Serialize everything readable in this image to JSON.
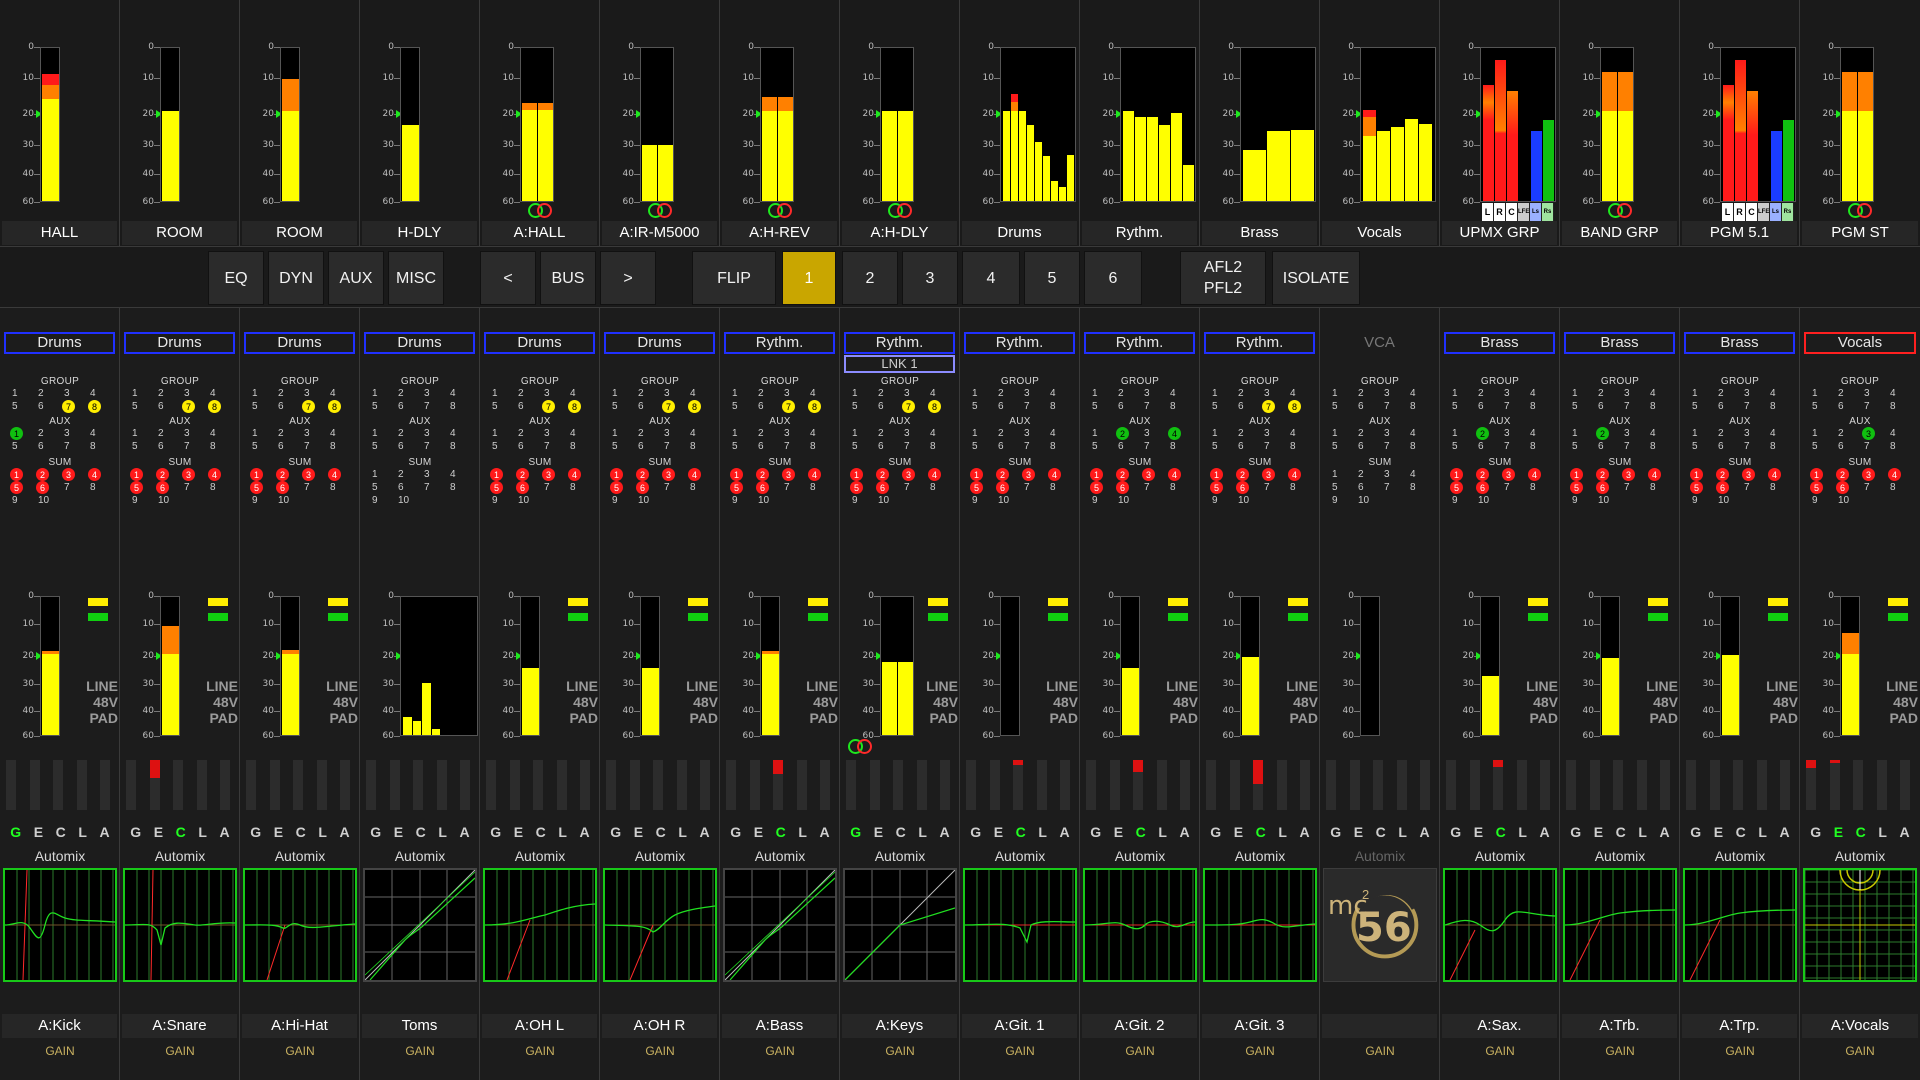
{
  "bridge": [
    {
      "name": "HALL",
      "fill": [
        0.66,
        0.09,
        0.07
      ],
      "bars": 1
    },
    {
      "name": "ROOM",
      "fill": [
        0.58,
        0.0,
        0.0
      ],
      "bars": 1
    },
    {
      "name": "ROOM",
      "fill": [
        0.58,
        0.21,
        0.0
      ],
      "bars": 1
    },
    {
      "name": "H-DLY",
      "fill": [
        0.49,
        0.0,
        0.0
      ],
      "bars": 1
    },
    {
      "name": "A:HALL",
      "fill": [
        0.59,
        0.04,
        0.0
      ],
      "bars": 2,
      "rings": true
    },
    {
      "name": "A:IR-M5000",
      "fill": [
        0.36,
        0.0,
        0.0
      ],
      "bars": 2,
      "rings": true
    },
    {
      "name": "A:H-REV",
      "fill": [
        0.58,
        0.09,
        0.0
      ],
      "bars": 2,
      "rings": true
    },
    {
      "name": "A:H-DLY",
      "fill": [
        0.58,
        0.0,
        0.0
      ],
      "bars": 2,
      "rings": true
    },
    {
      "name": "Drums",
      "multi": [
        0.58,
        0.58,
        0.58,
        0.49,
        0.38,
        0.29,
        0.13,
        0.09,
        0.3
      ]
    },
    {
      "name": "Rythm.",
      "multi": [
        0.58,
        0.54,
        0.54,
        0.49,
        0.57,
        0.23
      ]
    },
    {
      "name": "Brass",
      "multi": [
        0.33,
        0.45,
        0.46
      ]
    },
    {
      "name": "Vocals",
      "multi": [
        0.58,
        0.52,
        0.48,
        0.53,
        0.5
      ]
    },
    {
      "name": "UPMX GRP",
      "upmx": true,
      "chlabels": [
        "L",
        "R",
        "C",
        "LFE",
        "Ls",
        "Rs"
      ]
    },
    {
      "name": "BAND GRP",
      "fill": [
        0.58,
        0.25,
        0.0
      ],
      "bars": 2,
      "rings": true
    },
    {
      "name": "PGM 5.1",
      "upmx": true,
      "chlabels": [
        "L",
        "R",
        "C",
        "LFE",
        "Ls",
        "Rs"
      ]
    },
    {
      "name": "PGM ST",
      "fill": [
        0.58,
        0.25,
        0.0
      ],
      "bars": 2,
      "rings": true
    }
  ],
  "scale_labels": [
    "0",
    "10",
    "20",
    "30",
    "40",
    "60"
  ],
  "buttons": {
    "eq": "EQ",
    "dyn": "DYN",
    "aux": "AUX",
    "misc": "MISC",
    "prev": "<",
    "bus": "BUS",
    "next": ">",
    "flip": "FLIP",
    "bank1": "1",
    "bank2": "2",
    "bank3": "3",
    "bank4": "4",
    "bank5": "5",
    "bank6": "6",
    "afl": "AFL2",
    "pfl": "PFL2",
    "isolate": "ISOLATE"
  },
  "labels": {
    "group": "GROUP",
    "aux": "AUX",
    "sum": "SUM",
    "src_line": "LINE",
    "src_48v": "48V",
    "src_pad": "PAD",
    "automix": "Automix",
    "gain": "GAIN",
    "lnk": "LNK 1",
    "gecla": [
      "G",
      "E",
      "C",
      "L",
      "A"
    ],
    "logo_mc": "mc",
    "logo_sup": "2",
    "logo_num": "56"
  },
  "channels": [
    {
      "tag": "Drums",
      "name": "A:Kick",
      "group": [
        7,
        8
      ],
      "aux": [
        1
      ],
      "sum": [
        1,
        2,
        3,
        4,
        5,
        6
      ],
      "meter": [
        0.58,
        0.02,
        0.0
      ],
      "dyn": [
        0,
        0,
        0,
        0,
        0
      ],
      "gecla_on": [
        0
      ],
      "graph": "eq1"
    },
    {
      "tag": "Drums",
      "name": "A:Snare",
      "group": [
        7,
        8
      ],
      "aux": [],
      "sum": [
        1,
        2,
        3,
        4,
        5,
        6
      ],
      "meter": [
        0.58,
        0.2,
        0.0
      ],
      "dyn": [
        0,
        0.36,
        0,
        0,
        0
      ],
      "gecla_on": [
        2
      ],
      "graph": "eq2"
    },
    {
      "tag": "Drums",
      "name": "A:Hi-Hat",
      "group": [
        7,
        8
      ],
      "aux": [],
      "sum": [
        1,
        2,
        3,
        4,
        5,
        6
      ],
      "meter": [
        0.58,
        0.03,
        0.0
      ],
      "dyn": [
        0,
        0,
        0,
        0,
        0
      ],
      "gecla_on": [],
      "graph": "eq3"
    },
    {
      "tag": "Drums",
      "name": "Toms",
      "group": [],
      "aux": [],
      "sum": [],
      "multi": [
        0.13,
        0.1,
        0.37,
        0.04,
        0,
        0,
        0,
        0
      ],
      "dyn": [
        0,
        0,
        0,
        0,
        0
      ],
      "gecla_on": [],
      "graph": "dyn1",
      "white": true
    },
    {
      "tag": "Drums",
      "name": "A:OH L",
      "group": [
        7,
        8
      ],
      "aux": [],
      "sum": [
        1,
        2,
        3,
        4,
        5,
        6
      ],
      "meter": [
        0.48,
        0.0,
        0.0
      ],
      "dyn": [
        0,
        0,
        0,
        0,
        0
      ],
      "gecla_on": [],
      "graph": "eq4"
    },
    {
      "tag": "Drums",
      "name": "A:OH R",
      "group": [
        7,
        8
      ],
      "aux": [],
      "sum": [
        1,
        2,
        3,
        4,
        5,
        6
      ],
      "meter": [
        0.48,
        0.0,
        0.0
      ],
      "dyn": [
        0,
        0,
        0,
        0,
        0
      ],
      "gecla_on": [],
      "graph": "eq5"
    },
    {
      "tag": "Rythm.",
      "name": "A:Bass",
      "group": [
        7,
        8
      ],
      "aux": [],
      "sum": [
        1,
        2,
        3,
        4,
        5,
        6
      ],
      "meter": [
        0.58,
        0.02,
        0.0
      ],
      "dyn": [
        0,
        0,
        0.28,
        0,
        0
      ],
      "gecla_on": [
        2
      ],
      "graph": "dyn2",
      "white": true
    },
    {
      "tag": "Rythm.",
      "name": "A:Keys",
      "group": [
        7,
        8
      ],
      "aux": [],
      "sum": [
        1,
        2,
        3,
        4,
        5,
        6
      ],
      "meter": [
        0.52,
        0.0,
        0.0
      ],
      "bars": 2,
      "rings": true,
      "lnk": true,
      "dyn": [
        0,
        0,
        0,
        0,
        0
      ],
      "gecla_on": [
        0
      ],
      "graph": "dyn3",
      "white": true
    },
    {
      "tag": "Rythm.",
      "name": "A:Git. 1",
      "group": [],
      "aux": [],
      "sum": [
        1,
        2,
        3,
        4,
        5,
        6
      ],
      "meter": [
        0.0,
        0.0,
        0.0
      ],
      "dyn": [
        0,
        0,
        0.1,
        0,
        0
      ],
      "gecla_on": [
        2
      ],
      "graph": "eq6"
    },
    {
      "tag": "Rythm.",
      "name": "A:Git. 2",
      "group": [],
      "aux": [
        2,
        4
      ],
      "sum": [
        1,
        2,
        3,
        4,
        5,
        6
      ],
      "meter": [
        0.48,
        0.0,
        0.0
      ],
      "dyn": [
        0,
        0,
        0.24,
        0,
        0
      ],
      "gecla_on": [
        2
      ],
      "graph": "eq7"
    },
    {
      "tag": "Rythm.",
      "name": "A:Git. 3",
      "group": [
        7,
        8
      ],
      "aux": [],
      "sum": [
        1,
        2,
        3,
        4,
        5,
        6
      ],
      "meter": [
        0.56,
        0.0,
        0.0
      ],
      "dyn": [
        0,
        0,
        0.48,
        0,
        0
      ],
      "gecla_on": [
        2
      ],
      "graph": "eq8"
    },
    {
      "tag": "VCA",
      "name": "",
      "group": [],
      "aux": [],
      "sum": [],
      "meter": [
        0.0,
        0.0,
        0.0
      ],
      "dyn": [
        0,
        0,
        0,
        0,
        0
      ],
      "gecla_on": [],
      "graph": "logo",
      "vca": true
    },
    {
      "tag": "Brass",
      "name": "A:Sax.",
      "group": [],
      "aux": [
        2
      ],
      "sum": [
        1,
        2,
        3,
        4,
        5,
        6
      ],
      "meter": [
        0.42,
        0.0,
        0.0
      ],
      "dyn": [
        0,
        0,
        0.14,
        0,
        0
      ],
      "gecla_on": [
        2
      ],
      "graph": "eq9"
    },
    {
      "tag": "Brass",
      "name": "A:Trb.",
      "group": [],
      "aux": [
        2
      ],
      "sum": [
        1,
        2,
        3,
        4,
        5,
        6
      ],
      "meter": [
        0.55,
        0.0,
        0.0
      ],
      "dyn": [
        0,
        0,
        0,
        0,
        0
      ],
      "gecla_on": [],
      "graph": "eq10"
    },
    {
      "tag": "Brass",
      "name": "A:Trp.",
      "group": [],
      "aux": [],
      "sum": [
        1,
        2,
        3,
        4,
        5,
        6
      ],
      "meter": [
        0.57,
        0.0,
        0.0
      ],
      "dyn": [
        0,
        0,
        0,
        0,
        0
      ],
      "gecla_on": [],
      "graph": "eq10"
    },
    {
      "tag": "Vocals",
      "name": "A:Vocals",
      "group": [],
      "aux": [
        3
      ],
      "sum": [
        1,
        2,
        3,
        4,
        5,
        6
      ],
      "meter": [
        0.58,
        0.15,
        0.0
      ],
      "dyn": [
        0.16,
        0.06,
        0,
        0,
        0
      ],
      "gecla_on": [
        1,
        2
      ],
      "graph": "grid",
      "tagRed": true
    }
  ]
}
